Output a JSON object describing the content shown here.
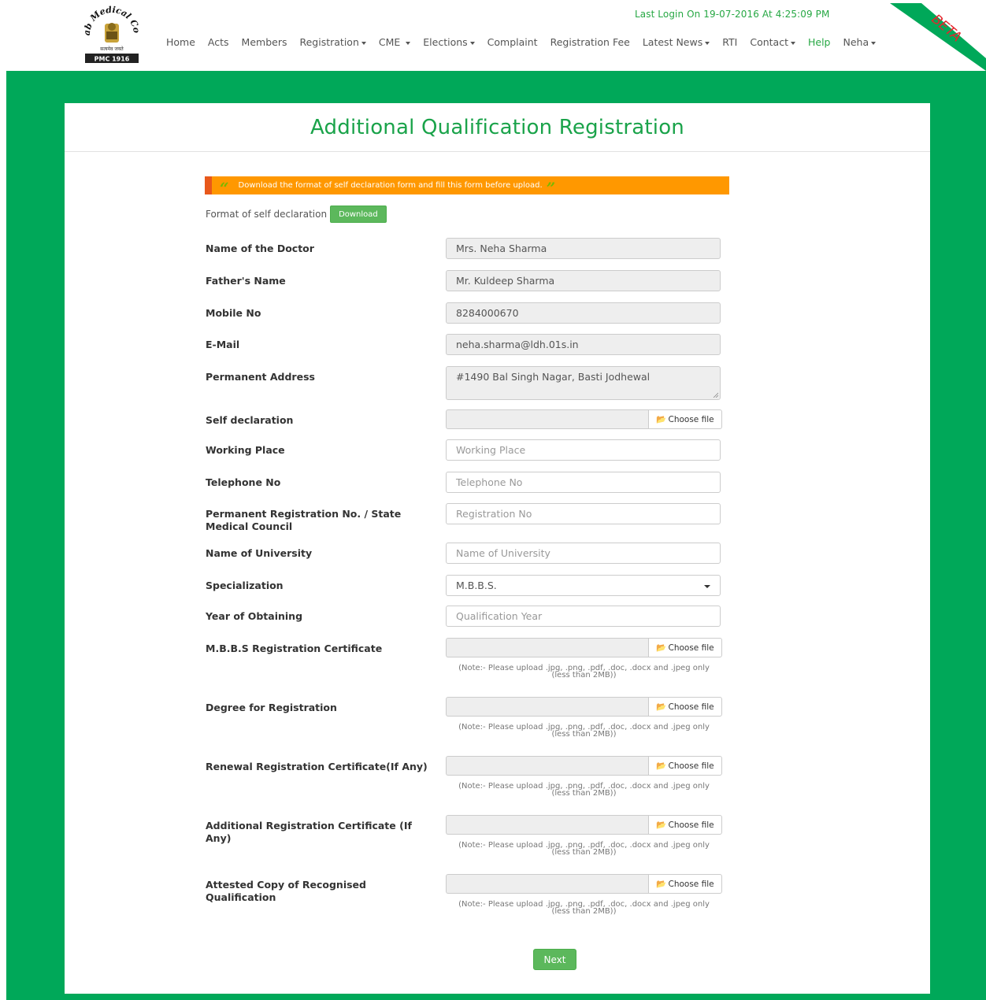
{
  "header": {
    "last_login": "Last Login On 19-07-2016 At 4:25:09 PM",
    "logo_text": "Punjab Medical Council",
    "logo_sub": "सत्यमेव जयते",
    "logo_badge": "PMC 1916",
    "beta": "BETA",
    "nav": [
      {
        "label": "Home"
      },
      {
        "label": "Acts"
      },
      {
        "label": "Members"
      },
      {
        "label": "Registration"
      },
      {
        "label": "CME"
      },
      {
        "label": "Elections"
      },
      {
        "label": "Complaint"
      },
      {
        "label": "Registration Fee"
      },
      {
        "label": "Latest News"
      },
      {
        "label": "RTI"
      },
      {
        "label": "Contact"
      },
      {
        "label": "Help"
      },
      {
        "label": "Neha"
      }
    ]
  },
  "page": {
    "title": "Additional Qualification Registration",
    "notice": "Download the format of self declaration form and fill this form before upload.",
    "self_declaration_format": "Format of self declaration",
    "download_label": "Download",
    "next_label": "Next"
  },
  "form": {
    "doctor_name": {
      "label": "Name of the Doctor",
      "value": "Mrs. Neha Sharma"
    },
    "father_name": {
      "label": "Father's Name",
      "value": "Mr. Kuldeep Sharma"
    },
    "mobile": {
      "label": "Mobile No",
      "value": "8284000670"
    },
    "email": {
      "label": "E-Mail",
      "value": "neha.sharma@ldh.01s.in"
    },
    "address": {
      "label": "Permanent Address",
      "value": "#1490 Bal Singh Nagar, Basti Jodhewal"
    },
    "self_declaration": {
      "label": "Self declaration"
    },
    "working_place": {
      "label": "Working Place",
      "placeholder": "Working Place"
    },
    "telephone": {
      "label": "Telephone No",
      "placeholder": "Telephone No"
    },
    "registration_no": {
      "label": "Permanent Registration No. / State Medical Council",
      "placeholder": "Registration No"
    },
    "university": {
      "label": "Name of University",
      "placeholder": "Name of University"
    },
    "specialization": {
      "label": "Specialization",
      "value": "M.B.B.S."
    },
    "year": {
      "label": "Year of Obtaining",
      "placeholder": "Qualification Year"
    },
    "mbbs_cert": {
      "label": "M.B.B.S Registration Certificate"
    },
    "degree": {
      "label": "Degree for Registration"
    },
    "renewal_cert": {
      "label": "Renewal Registration Certificate(If Any)"
    },
    "additional_cert": {
      "label": "Additional Registration Certificate (If Any)"
    },
    "attested_copy": {
      "label": "Attested Copy of Recognised Qualification"
    },
    "choose_file": "Choose file",
    "note_line1": "(Note:- Please upload .jpg, .png, .pdf, .doc, .docx and .jpeg only",
    "note_line2": "(less than 2MB))"
  },
  "colors": {
    "brand_green": "#00a859",
    "title_green": "#1aa34a",
    "notice_orange": "#ff9800",
    "button_green": "#5cb85c"
  }
}
